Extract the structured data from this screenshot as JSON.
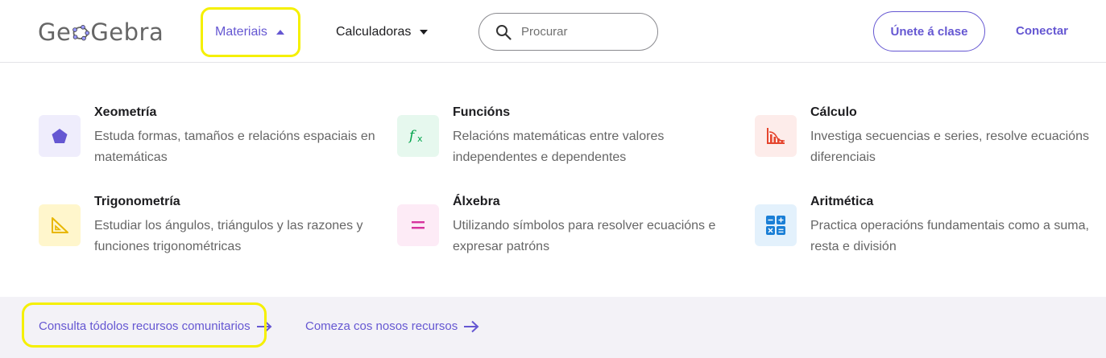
{
  "header": {
    "logo_text_left": "Ge",
    "logo_text_right": "Gebra",
    "nav": {
      "materials_label": "Materiais",
      "calculators_label": "Calculadoras"
    },
    "search": {
      "placeholder": "Procurar",
      "value": ""
    },
    "join_class_label": "Únete á clase",
    "login_label": "Conectar"
  },
  "menu": {
    "items": [
      {
        "title": "Xeometría",
        "desc": "Estuda formas, tamaños e relacións espaciais en matemáticas",
        "icon": "pentagon-icon",
        "bg": "#efedfc",
        "color": "#6557d2"
      },
      {
        "title": "Funcións",
        "desc": "Relacións matemáticas entre valores independentes e dependentes",
        "icon": "function-icon",
        "bg": "#e6f8ee",
        "color": "#00a34a"
      },
      {
        "title": "Cálculo",
        "desc": "Investiga secuencias e series, resolve ecuacións diferenciais",
        "icon": "bar-chart-icon",
        "bg": "#fdecea",
        "color": "#e5452e"
      },
      {
        "title": "Trigonometría",
        "desc": "Estudiar los ángulos, triángulos y las razones y funciones trigonométricas",
        "icon": "set-square-icon",
        "bg": "#fff6cc",
        "color": "#e8b700"
      },
      {
        "title": "Álxebra",
        "desc": "Utilizando símbolos para resolver ecuacións e expresar patróns",
        "icon": "equals-icon",
        "bg": "#fdebf6",
        "color": "#d6339e"
      },
      {
        "title": "Aritmética",
        "desc": "Practica operacións fundamentais como a suma, resta e división",
        "icon": "calculator-icon",
        "bg": "#e3f1fc",
        "color": "#1a7fd6"
      }
    ]
  },
  "footer": {
    "community_link": "Consulta tódolos recursos comunitarios",
    "start_link": "Comeza cos nosos recursos"
  },
  "colors": {
    "accent": "#6557d2",
    "highlight": "#f5f000",
    "footer_bg": "#f3f2f7"
  }
}
